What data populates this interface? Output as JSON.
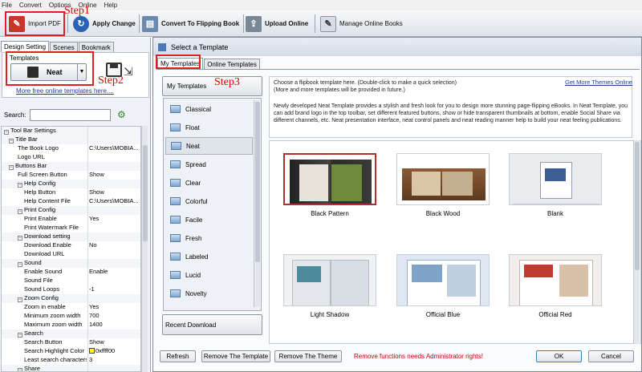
{
  "menu": [
    "File",
    "Convert",
    "Options",
    "Online",
    "Help"
  ],
  "toolbar": {
    "import_pdf": "Import PDF",
    "apply_change": "Apply Change",
    "convert": "Convert To Flipping Book",
    "upload": "Upload Online",
    "manage": "Manage Online Books"
  },
  "steps": {
    "step1": "Step1",
    "step2": "Step2",
    "step3": "Step3"
  },
  "left": {
    "tabs": [
      "Design Setting",
      "Scenes",
      "Bookmark"
    ],
    "templates_label": "Templates",
    "template_selected": "Neat",
    "more_link": "More free online templates here....",
    "search_label": "Search:"
  },
  "tree": [
    {
      "k": "Tool Bar Settings",
      "v": "",
      "lvl": 0,
      "sec": true
    },
    {
      "k": "Title Bar",
      "v": "",
      "lvl": 1,
      "sec": true
    },
    {
      "k": "The Book Logo",
      "v": "C:\\Users\\MOBIA...",
      "lvl": 2
    },
    {
      "k": "Logo URL",
      "v": "",
      "lvl": 2
    },
    {
      "k": "Buttons Bar",
      "v": "",
      "lvl": 1,
      "sec": true
    },
    {
      "k": "Full Screen Button",
      "v": "Show",
      "lvl": 2
    },
    {
      "k": "Help Config",
      "v": "",
      "lvl": 2,
      "sec": true
    },
    {
      "k": "Help Button",
      "v": "Show",
      "lvl": 3
    },
    {
      "k": "Help Content File",
      "v": "C:\\Users\\MOBIA...",
      "lvl": 3
    },
    {
      "k": "Print Config",
      "v": "",
      "lvl": 2,
      "sec": true
    },
    {
      "k": "Print Enable",
      "v": "Yes",
      "lvl": 3
    },
    {
      "k": "Print Watermark File",
      "v": "",
      "lvl": 3
    },
    {
      "k": "Download setting",
      "v": "",
      "lvl": 2,
      "sec": true
    },
    {
      "k": "Download Enable",
      "v": "No",
      "lvl": 3
    },
    {
      "k": "Download URL",
      "v": "",
      "lvl": 3
    },
    {
      "k": "Sound",
      "v": "",
      "lvl": 2,
      "sec": true
    },
    {
      "k": "Enable Sound",
      "v": "Enable",
      "lvl": 3
    },
    {
      "k": "Sound File",
      "v": "",
      "lvl": 3
    },
    {
      "k": "Sound Loops",
      "v": "-1",
      "lvl": 3
    },
    {
      "k": "Zoom Config",
      "v": "",
      "lvl": 2,
      "sec": true
    },
    {
      "k": "Zoom in enable",
      "v": "Yes",
      "lvl": 3
    },
    {
      "k": "Minimum zoom width",
      "v": "700",
      "lvl": 3
    },
    {
      "k": "Maximum zoom width",
      "v": "1400",
      "lvl": 3
    },
    {
      "k": "Search",
      "v": "",
      "lvl": 2,
      "sec": true
    },
    {
      "k": "Search Button",
      "v": "Show",
      "lvl": 3
    },
    {
      "k": "Search Highlight Color",
      "v": "0xffff00",
      "lvl": 3,
      "swatch": "#ffff00"
    },
    {
      "k": "Least search characters",
      "v": "3",
      "lvl": 3
    },
    {
      "k": "Share",
      "v": "",
      "lvl": 2,
      "sec": true
    }
  ],
  "dialog": {
    "title": "Select a Template",
    "tabs": [
      "My Templates",
      "Online Templates"
    ],
    "my_templates_btn": "My Templates",
    "intro": "Choose a flipbook template here. (Double-click to make a quick selection)",
    "intro2": "(More and more templates will be provided in future.)",
    "get_more": "Get More Themes Online",
    "desc": "Newly developed Neat Template provides a stylish and fresh look for you to design more stunning page-flipping eBooks. In Neat Template, you can add brand logo in the top toolbar, set different featured buttons, show or hide transparent thumbnails at bottom, enable Social Share via different channels, etc. Neat presentation interface, neat control panels and neat reading manner help to build your neat feeling publications.",
    "themes": [
      "Classical",
      "Float",
      "Neat",
      "Spread",
      "Clear",
      "Colorful",
      "Facile",
      "Fresh",
      "Labeled",
      "Lucid",
      "Novelty"
    ],
    "selected_theme": "Neat",
    "recent_download": "Recent Download",
    "templates": [
      "Black Pattern",
      "Black Wood",
      "Blank",
      "Light Shadow",
      "Official Blue",
      "Official Red"
    ],
    "refresh": "Refresh",
    "remove_template": "Remove The Template",
    "remove_theme": "Remove The Theme",
    "warning": "Remove functions needs Administrator rights!",
    "ok": "OK",
    "cancel": "Cancel"
  },
  "colors": {
    "warning": "#cc0000",
    "link": "#1a3c9e",
    "step": "#e00000"
  }
}
